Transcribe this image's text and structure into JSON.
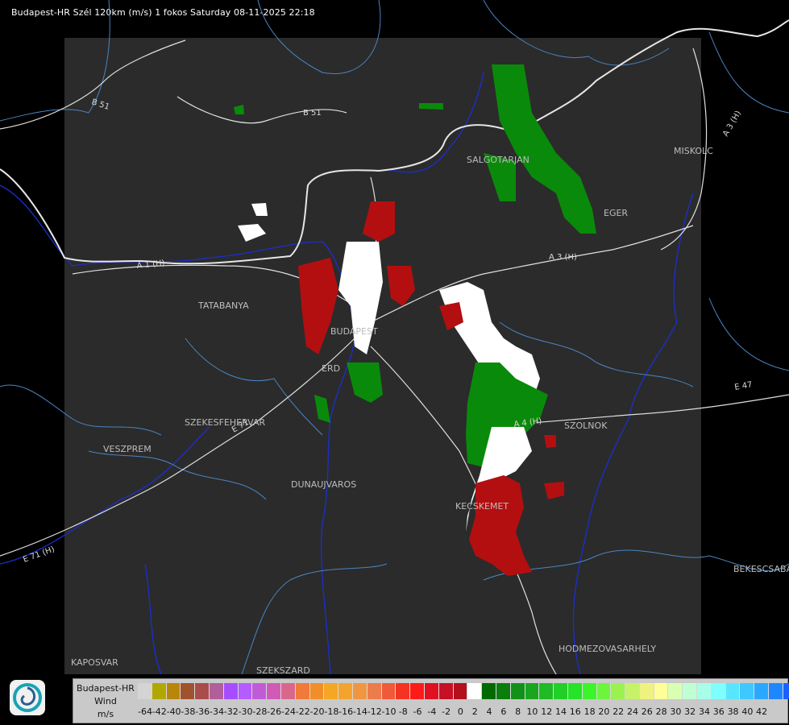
{
  "header": "Budapest-HR Szél 120km (m/s) 1 fokos Saturday 08-11-2025 22:18",
  "cities": [
    {
      "name": "SALGOTARJAN"
    },
    {
      "name": "MISKOLC"
    },
    {
      "name": "EGER"
    },
    {
      "name": "TATABANYA"
    },
    {
      "name": "BUDAPEST"
    },
    {
      "name": "ERD"
    },
    {
      "name": "SZEKESFEHERVAR"
    },
    {
      "name": "VESZPREM"
    },
    {
      "name": "DUNAUJVAROS"
    },
    {
      "name": "KECSKEMET"
    },
    {
      "name": "SZOLNOK"
    },
    {
      "name": "KAPOSVAR"
    },
    {
      "name": "SZEKSZARD"
    },
    {
      "name": "HODMEZOVASARHELY"
    },
    {
      "name": "BEKESCSABA"
    }
  ],
  "roads": [
    {
      "name": "B 51"
    },
    {
      "name": "B 51"
    },
    {
      "name": "A 3 (H)"
    },
    {
      "name": "A 3 (H)"
    },
    {
      "name": "A 1 (H)"
    },
    {
      "name": "E 71"
    },
    {
      "name": "E 71 (H)"
    },
    {
      "name": "E 47"
    },
    {
      "name": "A 4 (H)"
    }
  ],
  "legend": {
    "line1": "Budapest-HR",
    "line2": "Wind",
    "line3": "m/s",
    "colors": [
      "#d4d4d4",
      "#b0a800",
      "#b8860b",
      "#a0522d",
      "#a94c4c",
      "#b05f9a",
      "#a64dff",
      "#b45cff",
      "#c05bd8",
      "#d05bb6",
      "#d9678c",
      "#ef7a3a",
      "#f08e2a",
      "#f5a623",
      "#f3a42c",
      "#f09640",
      "#ec7c4c",
      "#f05a3a",
      "#f43322",
      "#ff1a1a",
      "#e11020",
      "#c71024",
      "#b3101c",
      "#ffffff",
      "#006a00",
      "#0a7d0a",
      "#12911a",
      "#1aa51f",
      "#1fba24",
      "#22cf26",
      "#25e326",
      "#3bf52a",
      "#6df53c",
      "#9bf24f",
      "#c6f26a",
      "#f0f27f",
      "#ffff99",
      "#d9ffb3",
      "#bfffd4",
      "#a8ffe8",
      "#7fffff",
      "#58e6ff",
      "#3ec8ff",
      "#2aa8ff",
      "#1e87ff",
      "#1c60ff",
      "#1a3cff",
      "#1c14ff"
    ],
    "labels": [
      "-64",
      "-42",
      "-40",
      "-38",
      "-36",
      "-34",
      "-32",
      "-30",
      "-28",
      "-26",
      "-24",
      "-22",
      "-20",
      "-18",
      "-16",
      "-14",
      "-12",
      "-10",
      "-8",
      "-6",
      "-4",
      "-2",
      "0",
      "2",
      "4",
      "6",
      "8",
      "10",
      "12",
      "14",
      "16",
      "18",
      "20",
      "22",
      "24",
      "26",
      "28",
      "30",
      "32",
      "34",
      "36",
      "38",
      "40",
      "42"
    ]
  }
}
